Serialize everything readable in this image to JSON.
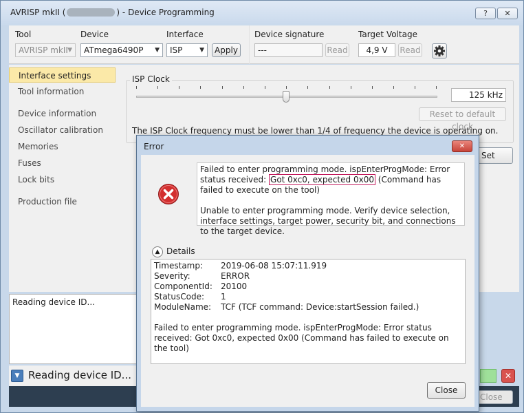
{
  "window": {
    "title_left": "AVRISP mkII (",
    "title_right": ") - Device Programming",
    "help_button": "?",
    "close_button": "✕"
  },
  "toolbar": {
    "tool_label": "Tool",
    "tool_value": "AVRISP mkII",
    "device_label": "Device",
    "device_value": "ATmega6490P",
    "interface_label": "Interface",
    "interface_value": "ISP",
    "apply_label": "Apply",
    "signature_label": "Device signature",
    "signature_value": "---",
    "signature_read_label": "Read",
    "voltage_label": "Target Voltage",
    "voltage_value": "4,9 V",
    "voltage_read_label": "Read",
    "settings_icon": "gear-icon"
  },
  "sidebar": {
    "items": [
      {
        "label": "Interface settings"
      },
      {
        "label": "Tool information"
      },
      {
        "label": "Device information"
      },
      {
        "label": "Oscillator calibration"
      },
      {
        "label": "Memories"
      },
      {
        "label": "Fuses"
      },
      {
        "label": "Lock bits"
      },
      {
        "label": "Production file"
      }
    ]
  },
  "isp": {
    "legend": "ISP Clock",
    "clock_value": "125 kHz",
    "reset_label": "Reset to default clock",
    "note": "The ISP Clock frequency must be lower than 1/4 of frequency the device is operating on.",
    "set_label": "Set"
  },
  "log": {
    "text": "Reading device ID..."
  },
  "status": {
    "text": "Reading device ID...",
    "close_label": "Close"
  },
  "dialog": {
    "title": "Error",
    "close_x": "✕",
    "icon": "error-icon",
    "msg_part1": "Failed to enter programming mode. ispEnterProgMode: Error status received: ",
    "msg_highlight": "Got 0xc0, expected 0x00",
    "msg_part2": " (Command has failed to execute on the tool)",
    "msg_second": "Unable to enter programming mode. Verify device selection, interface settings, target power, security bit, and connections to the target device.",
    "details_label": "Details",
    "details": {
      "rows": [
        {
          "key": "Timestamp:",
          "value": "2019-06-08 15:07:11.919"
        },
        {
          "key": "Severity:",
          "value": "ERROR"
        },
        {
          "key": "ComponentId:",
          "value": "20100"
        },
        {
          "key": "StatusCode:",
          "value": "1"
        },
        {
          "key": "ModuleName:",
          "value": "TCF (TCF command: Device:startSession failed.)"
        }
      ],
      "message": "Failed to enter programming mode. ispEnterProgMode: Error status received: Got 0xc0, expected 0x00 (Command has failed to execute on the tool)"
    },
    "close_button": "Close"
  },
  "colors": {
    "window_frame": "#c8d8ea",
    "selected_nav": "#fbe9a8",
    "highlight_border": "#c2185b",
    "error_red": "#d32f2f"
  }
}
